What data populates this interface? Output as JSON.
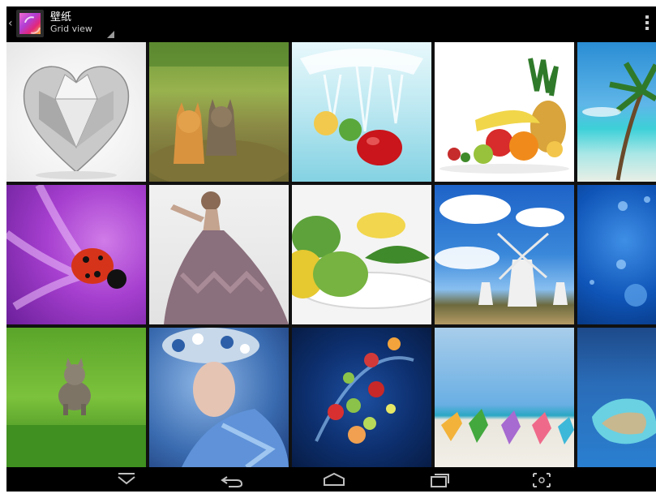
{
  "actionbar": {
    "title": "壁纸",
    "subtitle": "Grid view"
  },
  "grid": {
    "tiles": [
      {
        "name": "diamond-heart"
      },
      {
        "name": "two-kittens"
      },
      {
        "name": "fruit-splash"
      },
      {
        "name": "fruit-still-life"
      },
      {
        "name": "tropical-beach"
      },
      {
        "name": "ladybug-flower"
      },
      {
        "name": "woman-feather-dress"
      },
      {
        "name": "limes-lemons"
      },
      {
        "name": "windmills"
      },
      {
        "name": "water-drops"
      },
      {
        "name": "kitten-grass"
      },
      {
        "name": "woman-flower-crown"
      },
      {
        "name": "fruit-water-dark"
      },
      {
        "name": "beach-chairs"
      },
      {
        "name": "ocean-island"
      }
    ]
  },
  "navbar": {
    "icons": [
      "hide-keyboard-icon",
      "back-icon",
      "home-icon",
      "recent-apps-icon",
      "screenshot-icon"
    ]
  },
  "colors": {
    "background": "#000000",
    "icon": "#bfbfbf"
  }
}
